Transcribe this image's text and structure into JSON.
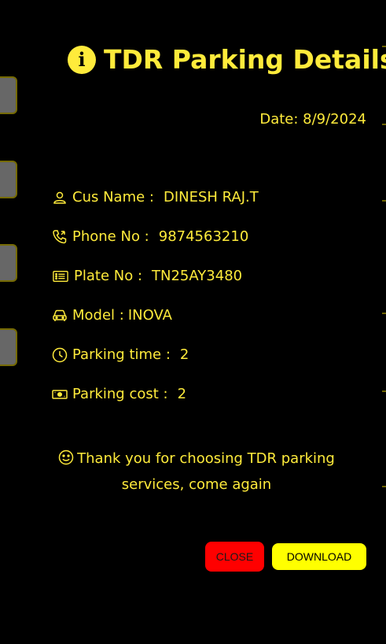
{
  "modal": {
    "title": "TDR Parking Details",
    "date_label": "Date: 8/9/2024"
  },
  "details": [
    {
      "label": "Cus Name :",
      "value": "DINESH RAJ.T",
      "icon": "user-icon"
    },
    {
      "label": "Phone No :",
      "value": "9874563210",
      "icon": "phone-icon"
    },
    {
      "label": "Plate No :",
      "value": "TN25AY3480",
      "icon": "list-card-icon"
    },
    {
      "label": "Model :",
      "value": "INOVA",
      "icon": "car-icon"
    },
    {
      "label": "Parking time :",
      "value": "2",
      "icon": "clock-icon"
    },
    {
      "label": "Parking cost :",
      "value": "2",
      "icon": "cash-icon"
    }
  ],
  "thanks": {
    "message": "Thank you for choosing TDR parking services, come again"
  },
  "actions": {
    "close_label": "CLOSE",
    "download_label": "DOWNLOAD"
  },
  "colors": {
    "accent": "#ffeb3b",
    "background": "#000000",
    "close_button": "#ff0000",
    "download_button": "#ffff00"
  }
}
